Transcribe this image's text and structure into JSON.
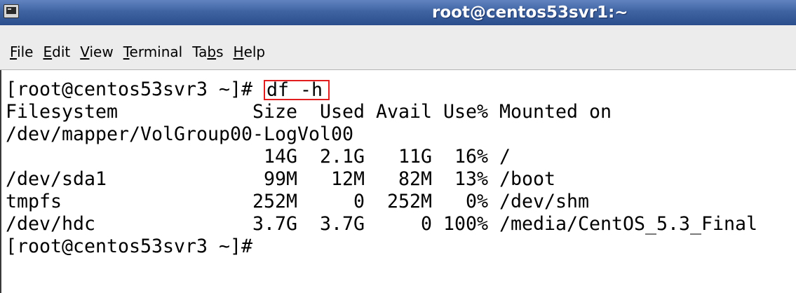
{
  "window": {
    "title": "root@centos53svr1:~",
    "icon": "terminal-icon"
  },
  "menu": [
    {
      "label": "File",
      "mnemonic": 0
    },
    {
      "label": "Edit",
      "mnemonic": 0
    },
    {
      "label": "View",
      "mnemonic": 0
    },
    {
      "label": "Terminal",
      "mnemonic": 0
    },
    {
      "label": "Tabs",
      "mnemonic": 2
    },
    {
      "label": "Help",
      "mnemonic": 0
    }
  ],
  "terminal": {
    "prompt": "[root@centos53svr3 ~]#",
    "command": "df -h",
    "df": {
      "headers": [
        "Filesystem",
        "Size",
        "Used",
        "Avail",
        "Use%",
        "Mounted on"
      ],
      "rows": [
        [
          "/dev/mapper/VolGroup00-LogVol00",
          "14G",
          "2.1G",
          "11G",
          "16%",
          "/"
        ],
        [
          "/dev/sda1",
          "99M",
          "12M",
          "82M",
          "13%",
          "/boot"
        ],
        [
          "tmpfs",
          "252M",
          "0",
          "252M",
          "0%",
          "/dev/shm"
        ],
        [
          "/dev/hdc",
          "3.7G",
          "3.7G",
          "0",
          "100%",
          "/media/CentOS_5.3_Final"
        ]
      ]
    },
    "final_prompt": "[root@centos53svr3 ~]#"
  },
  "colors": {
    "title_top": "#6184c0",
    "title_bottom": "#2b4d8b",
    "menu_bg": "#ececec",
    "term_bg": "#ffffff",
    "term_fg": "#000000",
    "highlight": "#e21d1d"
  }
}
